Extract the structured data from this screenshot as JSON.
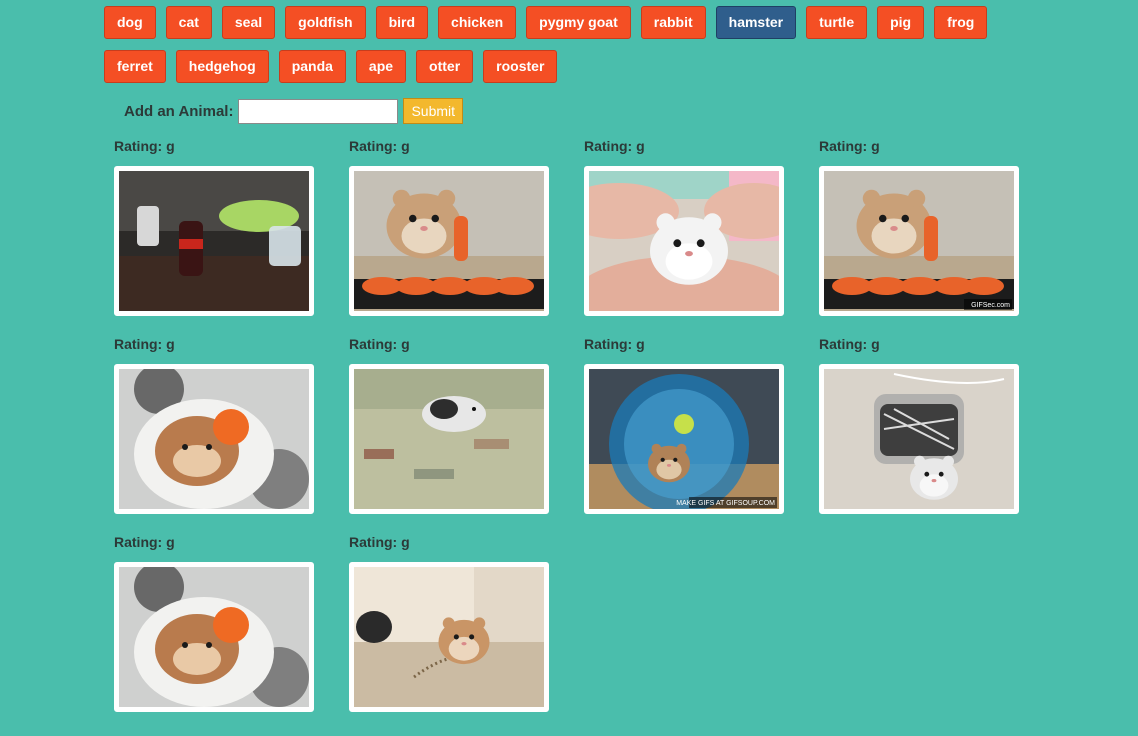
{
  "topics": [
    {
      "label": "dog",
      "active": false
    },
    {
      "label": "cat",
      "active": false
    },
    {
      "label": "seal",
      "active": false
    },
    {
      "label": "goldfish",
      "active": false
    },
    {
      "label": "bird",
      "active": false
    },
    {
      "label": "chicken",
      "active": false
    },
    {
      "label": "pygmy goat",
      "active": false
    },
    {
      "label": "rabbit",
      "active": false
    },
    {
      "label": "hamster",
      "active": true
    },
    {
      "label": "turtle",
      "active": false
    },
    {
      "label": "pig",
      "active": false
    },
    {
      "label": "frog",
      "active": false
    },
    {
      "label": "ferret",
      "active": false
    },
    {
      "label": "hedgehog",
      "active": false
    },
    {
      "label": "panda",
      "active": false
    },
    {
      "label": "ape",
      "active": false
    },
    {
      "label": "otter",
      "active": false
    },
    {
      "label": "rooster",
      "active": false
    }
  ],
  "form": {
    "label": "Add an Animal:",
    "input_value": "",
    "input_placeholder": "",
    "submit_label": "Submit"
  },
  "gifs": [
    {
      "rating": "Rating: g",
      "scene": "hamster-desk-soda",
      "watermark": ""
    },
    {
      "rating": "Rating: g",
      "scene": "hamster-eating-carrot",
      "watermark": ""
    },
    {
      "rating": "Rating: g",
      "scene": "white-hamster-in-hands",
      "watermark": ""
    },
    {
      "rating": "Rating: g",
      "scene": "hamster-eating-carrot",
      "watermark": "GIFSec.com"
    },
    {
      "rating": "Rating: g",
      "scene": "hamster-in-blanket",
      "watermark": ""
    },
    {
      "rating": "Rating: g",
      "scene": "hamster-on-rug",
      "watermark": ""
    },
    {
      "rating": "Rating: g",
      "scene": "hamster-in-wheel",
      "watermark": "MAKE GIFS AT GIFSOUP.COM"
    },
    {
      "rating": "Rating: g",
      "scene": "hamster-and-seed-jar",
      "watermark": ""
    },
    {
      "rating": "Rating: g",
      "scene": "hamster-in-blanket",
      "watermark": ""
    },
    {
      "rating": "Rating: g",
      "scene": "hamster-on-floor",
      "watermark": ""
    }
  ],
  "colors": {
    "page_background": "#4abeac",
    "button_default": "#f44f24",
    "button_active": "#2f5e8c",
    "submit_button": "#f3b82d"
  }
}
